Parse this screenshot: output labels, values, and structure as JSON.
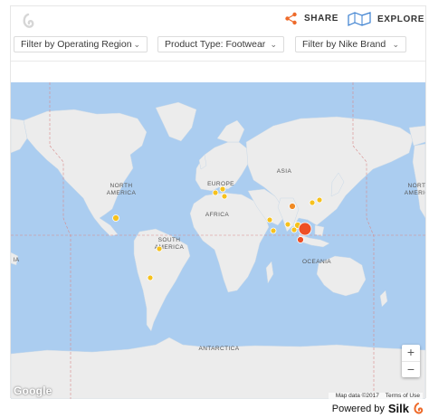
{
  "toolbar": {
    "share_label": "SHARE",
    "explore_label": "EXPLORE"
  },
  "filters": [
    {
      "label": "Filter by Operating Region"
    },
    {
      "label": "Product Type: Footwear"
    },
    {
      "label": "Filter by Nike Brand"
    }
  ],
  "map": {
    "labels": {
      "north_america": [
        "NORTH",
        "AMERICA"
      ],
      "europe": "EUROPE",
      "asia": "ASIA",
      "africa": "AFRICA",
      "south_america": [
        "SOUTH",
        "AMERICA"
      ],
      "oceania": "OCEANIA",
      "antarctica": "ANTARCTICA"
    },
    "attribution": "Google",
    "map_data": "Map data ©2017",
    "terms": "Terms of Use",
    "zoom_in": "+",
    "zoom_out": "−",
    "colors": {
      "water": "#abcdf0",
      "land": "#ececec",
      "marker_yellow": "#f6c11d",
      "marker_orange": "#f08a24",
      "marker_red": "#ee4f26",
      "brand": "#ee6a2a"
    }
  },
  "footer": {
    "powered_by": "Powered by",
    "brand": "Silk"
  }
}
